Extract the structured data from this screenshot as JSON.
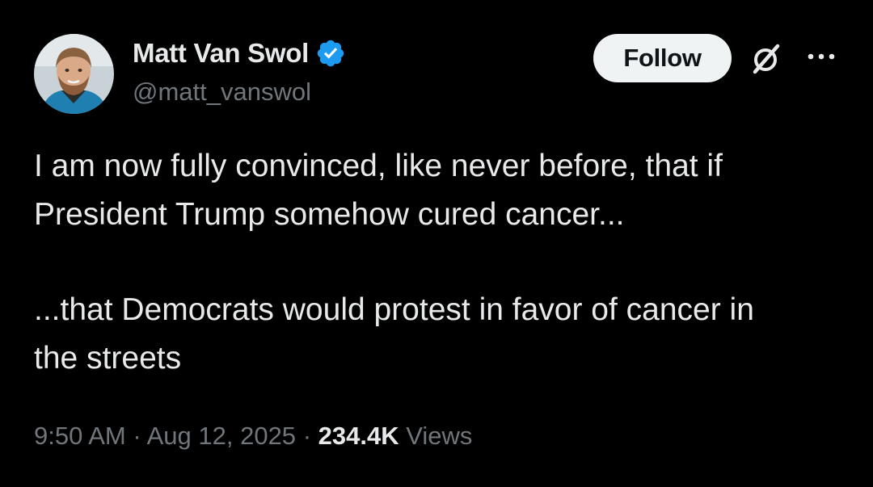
{
  "author": {
    "display_name": "Matt Van Swol",
    "handle": "@matt_vanswol",
    "verified": true,
    "avatar": "profile-photo-bearded-man"
  },
  "actions": {
    "follow_label": "Follow",
    "grok_icon": "grok-icon",
    "more_icon": "more-options-icon"
  },
  "tweet": {
    "line1": "I am now fully convinced, like never before, that if",
    "line2": "President Trump somehow cured cancer...",
    "line3": "...that Democrats would protest in favor of cancer in",
    "line4": "the streets"
  },
  "meta": {
    "time": "9:50 AM",
    "sep1": "·",
    "date": "Aug 12, 2025",
    "sep2": "·",
    "views_count": "234.4K",
    "views_label": "Views"
  },
  "colors": {
    "background": "#000000",
    "primary_text": "#e7e9ea",
    "secondary_text": "#71767b",
    "verified_blue": "#1d9bf0",
    "follow_bg": "#eff3f4"
  }
}
